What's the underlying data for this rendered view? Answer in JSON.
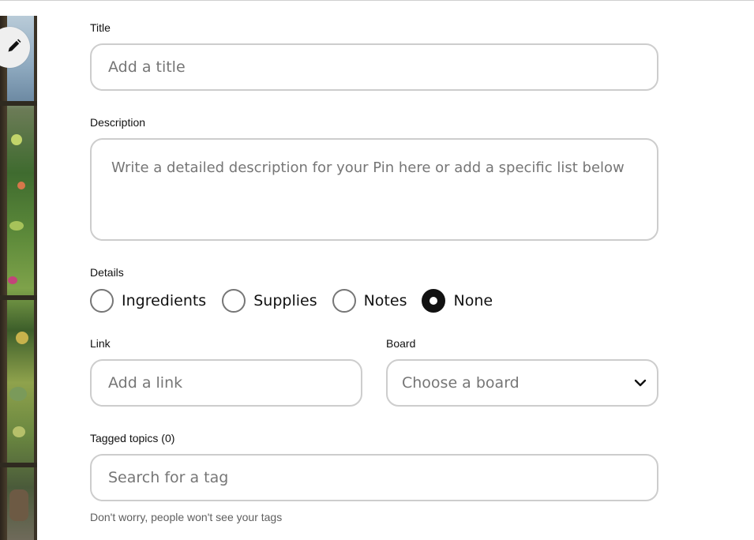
{
  "form": {
    "title": {
      "label": "Title",
      "placeholder": "Add a title"
    },
    "description": {
      "label": "Description",
      "placeholder": "Write a detailed description for your Pin here or add a specific list below"
    },
    "details": {
      "label": "Details",
      "options": [
        {
          "label": "Ingredients",
          "selected": false
        },
        {
          "label": "Supplies",
          "selected": false
        },
        {
          "label": "Notes",
          "selected": false
        },
        {
          "label": "None",
          "selected": true
        }
      ]
    },
    "link": {
      "label": "Link",
      "placeholder": "Add a link"
    },
    "board": {
      "label": "Board",
      "placeholder": "Choose a board"
    },
    "tagged_topics": {
      "label": "Tagged topics (0)",
      "placeholder": "Search for a tag",
      "helper": "Don't worry, people won't see your tags"
    }
  },
  "preview": {
    "edit_icon": "pencil-icon"
  },
  "colors": {
    "border": "#cdcdcd",
    "placeholder": "#767676",
    "text": "#111111",
    "radio_selected": "#111111"
  }
}
